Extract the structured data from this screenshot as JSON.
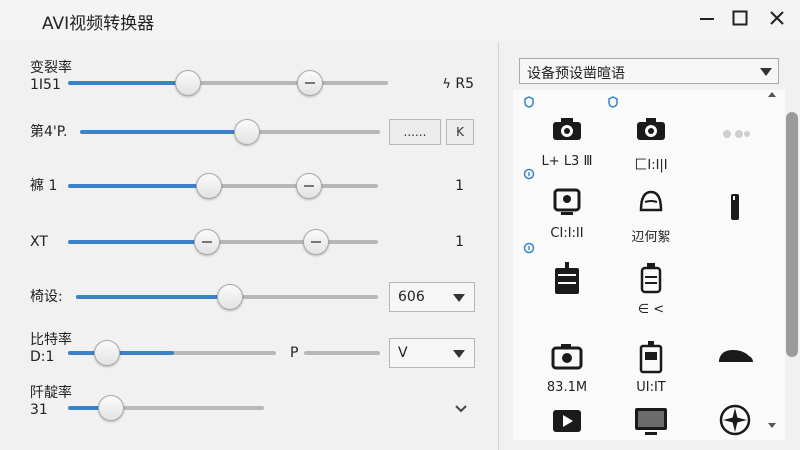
{
  "window": {
    "title": "AVI视频转换器"
  },
  "controls": {
    "row1": {
      "label": "变裂率",
      "sublabel": "1I51",
      "value": "R5"
    },
    "row2": {
      "label": "第4'P.",
      "button1": "......",
      "button2": "K"
    },
    "row3": {
      "label": "褯 1",
      "value": "1"
    },
    "row4": {
      "label": "XT",
      "value": "1"
    },
    "row5": {
      "label": "椅设:",
      "select_value": "606"
    },
    "row6": {
      "label": "比特率",
      "sublabel": "D:1",
      "mid_label": "P",
      "select_value": "V"
    },
    "row7": {
      "label": "阡靛率",
      "sublabel": "31"
    }
  },
  "presets": {
    "dropdown_label": "设备预设凿暄语",
    "items": [
      {
        "name": "camera-icon",
        "label": "L+ L3 Ⅲ"
      },
      {
        "name": "camera-icon",
        "label": "匚I:I|I"
      },
      {
        "name": "ellipsis-icon",
        "label": ""
      },
      {
        "name": "monitor-icon",
        "label": "CI:I:II"
      },
      {
        "name": "bell-icon",
        "label": "辺何絮"
      },
      {
        "name": "phone-icon",
        "label": ""
      },
      {
        "name": "mixer-icon",
        "label": ""
      },
      {
        "name": "player-icon",
        "label": "∈ <"
      },
      {
        "name": "blank-icon",
        "label": ""
      },
      {
        "name": "camera-icon",
        "label": "83.1M"
      },
      {
        "name": "battery-icon",
        "label": "UI:IT"
      },
      {
        "name": "car-icon",
        "label": ""
      },
      {
        "name": "video-icon",
        "label": ""
      },
      {
        "name": "tv-icon",
        "label": ""
      },
      {
        "name": "compass-icon",
        "label": ""
      }
    ]
  },
  "colors": {
    "accent": "#3b82c9",
    "track": "#b8b8b8",
    "window_bg": "#f1f1f1"
  }
}
